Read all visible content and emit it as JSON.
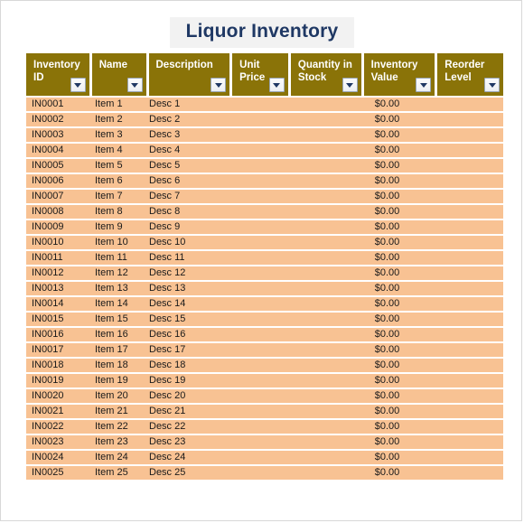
{
  "page": {
    "title": "Liquor Inventory"
  },
  "table": {
    "columns": [
      {
        "label": "Inventory ID",
        "name": "inventory-id",
        "filter": "filter-dropdown-icon"
      },
      {
        "label": "Name",
        "name": "name",
        "filter": "filter-dropdown-icon"
      },
      {
        "label": "Description",
        "name": "description",
        "filter": "filter-dropdown-icon"
      },
      {
        "label": "Unit Price",
        "name": "unit-price",
        "filter": "filter-dropdown-icon"
      },
      {
        "label": "Quantity in Stock",
        "name": "quantity-in-stock",
        "filter": "filter-dropdown-icon"
      },
      {
        "label": "Inventory Value",
        "name": "inventory-value",
        "filter": "filter-dropdown-icon"
      },
      {
        "label": "Reorder Level",
        "name": "reorder-level",
        "filter": "filter-dropdown-icon"
      }
    ],
    "rows": [
      {
        "inventory_id": "IN0001",
        "name": "Item 1",
        "description": "Desc 1",
        "unit_price": "",
        "quantity_in_stock": "",
        "inventory_value": "$0.00",
        "reorder_level": ""
      },
      {
        "inventory_id": "IN0002",
        "name": "Item 2",
        "description": "Desc 2",
        "unit_price": "",
        "quantity_in_stock": "",
        "inventory_value": "$0.00",
        "reorder_level": ""
      },
      {
        "inventory_id": "IN0003",
        "name": "Item 3",
        "description": "Desc 3",
        "unit_price": "",
        "quantity_in_stock": "",
        "inventory_value": "$0.00",
        "reorder_level": ""
      },
      {
        "inventory_id": "IN0004",
        "name": "Item 4",
        "description": "Desc 4",
        "unit_price": "",
        "quantity_in_stock": "",
        "inventory_value": "$0.00",
        "reorder_level": ""
      },
      {
        "inventory_id": "IN0005",
        "name": "Item 5",
        "description": "Desc 5",
        "unit_price": "",
        "quantity_in_stock": "",
        "inventory_value": "$0.00",
        "reorder_level": ""
      },
      {
        "inventory_id": "IN0006",
        "name": "Item 6",
        "description": "Desc 6",
        "unit_price": "",
        "quantity_in_stock": "",
        "inventory_value": "$0.00",
        "reorder_level": ""
      },
      {
        "inventory_id": "IN0007",
        "name": "Item 7",
        "description": "Desc 7",
        "unit_price": "",
        "quantity_in_stock": "",
        "inventory_value": "$0.00",
        "reorder_level": ""
      },
      {
        "inventory_id": "IN0008",
        "name": "Item 8",
        "description": "Desc 8",
        "unit_price": "",
        "quantity_in_stock": "",
        "inventory_value": "$0.00",
        "reorder_level": ""
      },
      {
        "inventory_id": "IN0009",
        "name": "Item 9",
        "description": "Desc 9",
        "unit_price": "",
        "quantity_in_stock": "",
        "inventory_value": "$0.00",
        "reorder_level": ""
      },
      {
        "inventory_id": "IN0010",
        "name": "Item 10",
        "description": "Desc 10",
        "unit_price": "",
        "quantity_in_stock": "",
        "inventory_value": "$0.00",
        "reorder_level": ""
      },
      {
        "inventory_id": "IN0011",
        "name": "Item 11",
        "description": "Desc 11",
        "unit_price": "",
        "quantity_in_stock": "",
        "inventory_value": "$0.00",
        "reorder_level": ""
      },
      {
        "inventory_id": "IN0012",
        "name": "Item 12",
        "description": "Desc 12",
        "unit_price": "",
        "quantity_in_stock": "",
        "inventory_value": "$0.00",
        "reorder_level": ""
      },
      {
        "inventory_id": "IN0013",
        "name": "Item 13",
        "description": "Desc 13",
        "unit_price": "",
        "quantity_in_stock": "",
        "inventory_value": "$0.00",
        "reorder_level": ""
      },
      {
        "inventory_id": "IN0014",
        "name": "Item 14",
        "description": "Desc 14",
        "unit_price": "",
        "quantity_in_stock": "",
        "inventory_value": "$0.00",
        "reorder_level": ""
      },
      {
        "inventory_id": "IN0015",
        "name": "Item 15",
        "description": "Desc 15",
        "unit_price": "",
        "quantity_in_stock": "",
        "inventory_value": "$0.00",
        "reorder_level": ""
      },
      {
        "inventory_id": "IN0016",
        "name": "Item 16",
        "description": "Desc 16",
        "unit_price": "",
        "quantity_in_stock": "",
        "inventory_value": "$0.00",
        "reorder_level": ""
      },
      {
        "inventory_id": "IN0017",
        "name": "Item 17",
        "description": "Desc 17",
        "unit_price": "",
        "quantity_in_stock": "",
        "inventory_value": "$0.00",
        "reorder_level": ""
      },
      {
        "inventory_id": "IN0018",
        "name": "Item 18",
        "description": "Desc 18",
        "unit_price": "",
        "quantity_in_stock": "",
        "inventory_value": "$0.00",
        "reorder_level": ""
      },
      {
        "inventory_id": "IN0019",
        "name": "Item 19",
        "description": "Desc 19",
        "unit_price": "",
        "quantity_in_stock": "",
        "inventory_value": "$0.00",
        "reorder_level": ""
      },
      {
        "inventory_id": "IN0020",
        "name": "Item 20",
        "description": "Desc 20",
        "unit_price": "",
        "quantity_in_stock": "",
        "inventory_value": "$0.00",
        "reorder_level": ""
      },
      {
        "inventory_id": "IN0021",
        "name": "Item 21",
        "description": "Desc 21",
        "unit_price": "",
        "quantity_in_stock": "",
        "inventory_value": "$0.00",
        "reorder_level": ""
      },
      {
        "inventory_id": "IN0022",
        "name": "Item 22",
        "description": "Desc 22",
        "unit_price": "",
        "quantity_in_stock": "",
        "inventory_value": "$0.00",
        "reorder_level": ""
      },
      {
        "inventory_id": "IN0023",
        "name": "Item 23",
        "description": "Desc 23",
        "unit_price": "",
        "quantity_in_stock": "",
        "inventory_value": "$0.00",
        "reorder_level": ""
      },
      {
        "inventory_id": "IN0024",
        "name": "Item 24",
        "description": "Desc 24",
        "unit_price": "",
        "quantity_in_stock": "",
        "inventory_value": "$0.00",
        "reorder_level": ""
      },
      {
        "inventory_id": "IN0025",
        "name": "Item 25",
        "description": "Desc 25",
        "unit_price": "",
        "quantity_in_stock": "",
        "inventory_value": "$0.00",
        "reorder_level": ""
      }
    ]
  },
  "colors": {
    "header_background": "#8a7308",
    "header_text": "#ffffff",
    "row_background": "#f8c293",
    "title_text": "#1f3864",
    "title_background": "#f2f2f2",
    "page_border": "#d8d8d8"
  }
}
